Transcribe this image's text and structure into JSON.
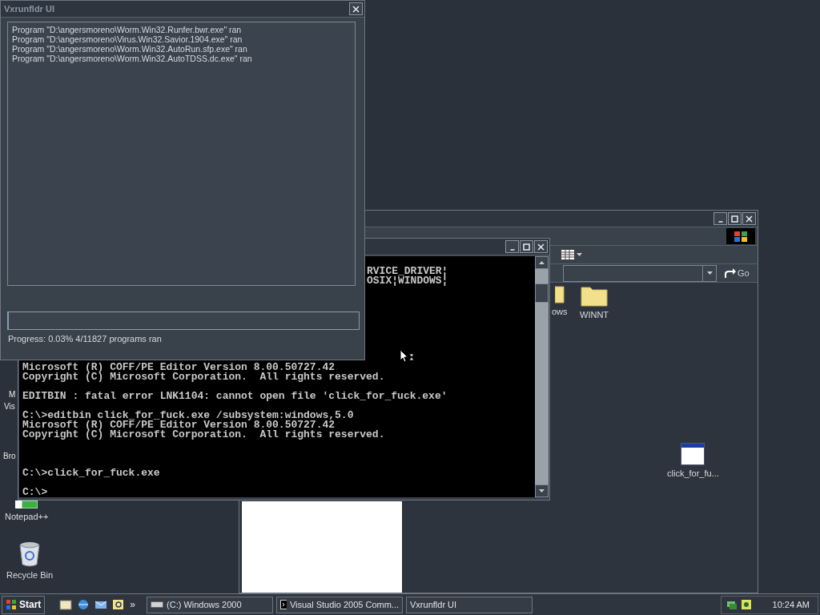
{
  "desktop": {
    "partial_labels": [
      "M",
      "Vis",
      "Bro"
    ],
    "icons": [
      {
        "kind": "notepad",
        "label": "Notepad++"
      },
      {
        "kind": "recycle",
        "label": "Recycle Bin"
      }
    ]
  },
  "explorer": {
    "items": [
      {
        "kind": "partial_folder",
        "label": "ows"
      },
      {
        "kind": "folder",
        "label": "WINNT"
      },
      {
        "kind": "program",
        "label": "click_for_fu..."
      }
    ],
    "go_label": "Go"
  },
  "console": {
    "top_lines": [
      "RVICE_DRIVER¦",
      "OSIX¦WINDOWS¦"
    ],
    "output_blocks": [
      [
        "Microsoft (R) COFF/PE Editor Version 8.00.50727.42",
        "Copyright (C) Microsoft Corporation.  All rights reserved."
      ],
      [
        "EDITBIN : fatal error LNK1104: cannot open file 'click_for_fuck.exe'"
      ],
      [
        "C:\\>editbin click_for_fuck.exe /subsystem:windows,5.0",
        "Microsoft (R) COFF/PE Editor Version 8.00.50727.42",
        "Copyright (C) Microsoft Corporation.  All rights reserved."
      ]
    ],
    "prompt_blocks": [
      [
        "C:\\>click_for_fuck.exe"
      ],
      [
        "C:\\>"
      ]
    ]
  },
  "vxrunfldr": {
    "title": "Vxrunfldr UI",
    "log": [
      "Program \"D:\\angersmoreno\\Worm.Win32.Runfer.bwr.exe\" ran",
      "Program \"D:\\angersmoreno\\Virus.Win32.Savior.1904.exe\" ran",
      "Program \"D:\\angersmoreno\\Worm.Win32.AutoRun.sfp.exe\" ran",
      "Program \"D:\\angersmoreno\\Worm.Win32.AutoTDSS.dc.exe\" ran"
    ],
    "progress": {
      "level": 0.0003
    },
    "status": "Progress: 0.03% 4/11827 programs ran"
  },
  "taskbar": {
    "start": "Start",
    "more": "»",
    "tasks": [
      {
        "kind": "drive",
        "label": "(C:) Windows 2000"
      },
      {
        "kind": "console",
        "label": "Visual Studio 2005 Comm..."
      },
      {
        "kind": "none",
        "label": "Vxrunfldr UI"
      }
    ],
    "clock": "10:24 AM"
  }
}
